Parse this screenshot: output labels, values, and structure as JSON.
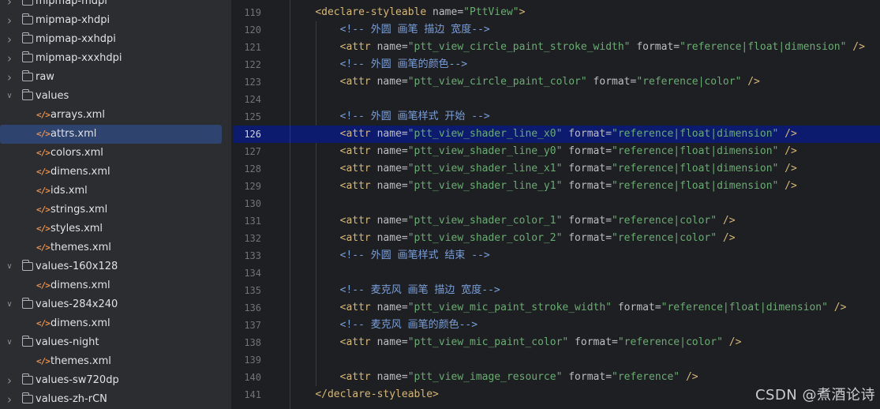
{
  "project_tree": [
    {
      "label": "mipmap-mdpi",
      "type": "folder",
      "depth": 0,
      "expanded": false
    },
    {
      "label": "mipmap-xhdpi",
      "type": "folder",
      "depth": 0,
      "expanded": false
    },
    {
      "label": "mipmap-xxhdpi",
      "type": "folder",
      "depth": 0,
      "expanded": false
    },
    {
      "label": "mipmap-xxxhdpi",
      "type": "folder",
      "depth": 0,
      "expanded": false
    },
    {
      "label": "raw",
      "type": "folder",
      "depth": 0,
      "expanded": false
    },
    {
      "label": "values",
      "type": "folder",
      "depth": 0,
      "expanded": true
    },
    {
      "label": "arrays.xml",
      "type": "xml",
      "depth": 1
    },
    {
      "label": "attrs.xml",
      "type": "xml",
      "depth": 1,
      "selected": true
    },
    {
      "label": "colors.xml",
      "type": "xml",
      "depth": 1
    },
    {
      "label": "dimens.xml",
      "type": "xml",
      "depth": 1
    },
    {
      "label": "ids.xml",
      "type": "xml",
      "depth": 1
    },
    {
      "label": "strings.xml",
      "type": "xml",
      "depth": 1
    },
    {
      "label": "styles.xml",
      "type": "xml",
      "depth": 1
    },
    {
      "label": "themes.xml",
      "type": "xml",
      "depth": 1
    },
    {
      "label": "values-160x128",
      "type": "folder",
      "depth": 0,
      "expanded": true
    },
    {
      "label": "dimens.xml",
      "type": "xml",
      "depth": 1
    },
    {
      "label": "values-284x240",
      "type": "folder",
      "depth": 0,
      "expanded": true
    },
    {
      "label": "dimens.xml",
      "type": "xml",
      "depth": 1
    },
    {
      "label": "values-night",
      "type": "folder",
      "depth": 0,
      "expanded": true
    },
    {
      "label": "themes.xml",
      "type": "xml",
      "depth": 1
    },
    {
      "label": "values-sw720dp",
      "type": "folder",
      "depth": 0,
      "expanded": false
    },
    {
      "label": "values-zh-rCN",
      "type": "folder",
      "depth": 0,
      "expanded": false
    }
  ],
  "icons": {
    "folder": "folder-icon",
    "xml": "xml-file-icon",
    "expanded": "chevron-down-icon",
    "collapsed": "chevron-right-icon",
    "intention": "lightbulb-icon"
  },
  "editor": {
    "active_line": 126,
    "lines": [
      {
        "num": "119",
        "indent": 1,
        "tokens": [
          {
            "t": "<declare-styleable",
            "c": "tag"
          },
          {
            "t": " name",
            "c": "attr"
          },
          {
            "t": "=",
            "c": "punc"
          },
          {
            "t": "\"PttView\"",
            "c": "val"
          },
          {
            "t": ">",
            "c": "tag"
          }
        ]
      },
      {
        "num": "120",
        "indent": 2,
        "tokens": [
          {
            "t": "<!-- 外圆 画笔 描边 宽度-->",
            "c": "com"
          }
        ]
      },
      {
        "num": "121",
        "indent": 2,
        "tokens": [
          {
            "t": "<attr",
            "c": "tag"
          },
          {
            "t": " name",
            "c": "attr"
          },
          {
            "t": "=",
            "c": "punc"
          },
          {
            "t": "\"ptt_view_circle_paint_stroke_width\"",
            "c": "val"
          },
          {
            "t": " format",
            "c": "attr"
          },
          {
            "t": "=",
            "c": "punc"
          },
          {
            "t": "\"reference|float|dimension\"",
            "c": "val"
          },
          {
            "t": " />",
            "c": "tag"
          }
        ]
      },
      {
        "num": "122",
        "indent": 2,
        "tokens": [
          {
            "t": "<!-- 外圆 画笔的颜色-->",
            "c": "com"
          }
        ]
      },
      {
        "num": "123",
        "indent": 2,
        "tokens": [
          {
            "t": "<attr",
            "c": "tag"
          },
          {
            "t": " name",
            "c": "attr"
          },
          {
            "t": "=",
            "c": "punc"
          },
          {
            "t": "\"ptt_view_circle_paint_color\"",
            "c": "val"
          },
          {
            "t": " format",
            "c": "attr"
          },
          {
            "t": "=",
            "c": "punc"
          },
          {
            "t": "\"reference|color\"",
            "c": "val"
          },
          {
            "t": " />",
            "c": "tag"
          }
        ]
      },
      {
        "num": "124",
        "indent": 0,
        "tokens": []
      },
      {
        "num": "125",
        "indent": 2,
        "tokens": [
          {
            "t": "<!-- 外圆 画笔样式 开始 -->",
            "c": "com"
          }
        ]
      },
      {
        "num": "126",
        "indent": 2,
        "tokens": [
          {
            "t": "<attr",
            "c": "tag"
          },
          {
            "t": " name",
            "c": "attr"
          },
          {
            "t": "=",
            "c": "punc"
          },
          {
            "t": "\"ptt_view_shader_line_x0\"",
            "c": "val"
          },
          {
            "t": " format",
            "c": "attr"
          },
          {
            "t": "=",
            "c": "punc"
          },
          {
            "t": "\"reference|float|dimension\"",
            "c": "val"
          },
          {
            "t": " />",
            "c": "tag"
          }
        ]
      },
      {
        "num": "127",
        "indent": 2,
        "tokens": [
          {
            "t": "<attr",
            "c": "tag"
          },
          {
            "t": " name",
            "c": "attr"
          },
          {
            "t": "=",
            "c": "punc"
          },
          {
            "t": "\"ptt_view_shader_line_y0\"",
            "c": "val"
          },
          {
            "t": " format",
            "c": "attr"
          },
          {
            "t": "=",
            "c": "punc"
          },
          {
            "t": "\"reference|float|dimension\"",
            "c": "val"
          },
          {
            "t": " />",
            "c": "tag"
          }
        ]
      },
      {
        "num": "128",
        "indent": 2,
        "tokens": [
          {
            "t": "<attr",
            "c": "tag"
          },
          {
            "t": " name",
            "c": "attr"
          },
          {
            "t": "=",
            "c": "punc"
          },
          {
            "t": "\"ptt_view_shader_line_x1\"",
            "c": "val"
          },
          {
            "t": " format",
            "c": "attr"
          },
          {
            "t": "=",
            "c": "punc"
          },
          {
            "t": "\"reference|float|dimension\"",
            "c": "val"
          },
          {
            "t": " />",
            "c": "tag"
          }
        ]
      },
      {
        "num": "129",
        "indent": 2,
        "tokens": [
          {
            "t": "<attr",
            "c": "tag"
          },
          {
            "t": " name",
            "c": "attr"
          },
          {
            "t": "=",
            "c": "punc"
          },
          {
            "t": "\"ptt_view_shader_line_y1\"",
            "c": "val"
          },
          {
            "t": " format",
            "c": "attr"
          },
          {
            "t": "=",
            "c": "punc"
          },
          {
            "t": "\"reference|float|dimension\"",
            "c": "val"
          },
          {
            "t": " />",
            "c": "tag"
          }
        ]
      },
      {
        "num": "130",
        "indent": 0,
        "tokens": []
      },
      {
        "num": "131",
        "indent": 2,
        "tokens": [
          {
            "t": "<attr",
            "c": "tag"
          },
          {
            "t": " name",
            "c": "attr"
          },
          {
            "t": "=",
            "c": "punc"
          },
          {
            "t": "\"ptt_view_shader_color_1\"",
            "c": "val"
          },
          {
            "t": " format",
            "c": "attr"
          },
          {
            "t": "=",
            "c": "punc"
          },
          {
            "t": "\"reference|color\"",
            "c": "val"
          },
          {
            "t": " />",
            "c": "tag"
          }
        ]
      },
      {
        "num": "132",
        "indent": 2,
        "tokens": [
          {
            "t": "<attr",
            "c": "tag"
          },
          {
            "t": " name",
            "c": "attr"
          },
          {
            "t": "=",
            "c": "punc"
          },
          {
            "t": "\"ptt_view_shader_color_2\"",
            "c": "val"
          },
          {
            "t": " format",
            "c": "attr"
          },
          {
            "t": "=",
            "c": "punc"
          },
          {
            "t": "\"reference|color\"",
            "c": "val"
          },
          {
            "t": " />",
            "c": "tag"
          }
        ]
      },
      {
        "num": "133",
        "indent": 2,
        "tokens": [
          {
            "t": "<!-- 外圆 画笔样式 结束 -->",
            "c": "com"
          }
        ]
      },
      {
        "num": "134",
        "indent": 0,
        "tokens": []
      },
      {
        "num": "135",
        "indent": 2,
        "tokens": [
          {
            "t": "<!-- 麦克风 画笔 描边 宽度-->",
            "c": "com"
          }
        ]
      },
      {
        "num": "136",
        "indent": 2,
        "tokens": [
          {
            "t": "<attr",
            "c": "tag"
          },
          {
            "t": " name",
            "c": "attr"
          },
          {
            "t": "=",
            "c": "punc"
          },
          {
            "t": "\"ptt_view_mic_paint_stroke_width\"",
            "c": "val"
          },
          {
            "t": " format",
            "c": "attr"
          },
          {
            "t": "=",
            "c": "punc"
          },
          {
            "t": "\"reference|float|dimension\"",
            "c": "val"
          },
          {
            "t": " />",
            "c": "tag"
          }
        ]
      },
      {
        "num": "137",
        "indent": 2,
        "tokens": [
          {
            "t": "<!-- 麦克风 画笔的颜色-->",
            "c": "com"
          }
        ]
      },
      {
        "num": "138",
        "indent": 2,
        "tokens": [
          {
            "t": "<attr",
            "c": "tag"
          },
          {
            "t": " name",
            "c": "attr"
          },
          {
            "t": "=",
            "c": "punc"
          },
          {
            "t": "\"ptt_view_mic_paint_color\"",
            "c": "val"
          },
          {
            "t": " format",
            "c": "attr"
          },
          {
            "t": "=",
            "c": "punc"
          },
          {
            "t": "\"reference|color\"",
            "c": "val"
          },
          {
            "t": " />",
            "c": "tag"
          }
        ]
      },
      {
        "num": "139",
        "indent": 0,
        "tokens": []
      },
      {
        "num": "140",
        "indent": 2,
        "tokens": [
          {
            "t": "<attr",
            "c": "tag"
          },
          {
            "t": " name",
            "c": "attr"
          },
          {
            "t": "=",
            "c": "punc"
          },
          {
            "t": "\"ptt_view_image_resource\"",
            "c": "val"
          },
          {
            "t": " format",
            "c": "attr"
          },
          {
            "t": "=",
            "c": "punc"
          },
          {
            "t": "\"reference\"",
            "c": "val"
          },
          {
            "t": " />",
            "c": "tag"
          }
        ]
      },
      {
        "num": "141",
        "indent": 1,
        "tokens": [
          {
            "t": "</declare-styleable>",
            "c": "tag"
          }
        ]
      }
    ]
  },
  "watermark": "CSDN @煮酒论诗",
  "colors": {
    "selection": "#2e436e",
    "active_line": "#0d1b6f",
    "tag": "#d5b778",
    "value": "#6aab73",
    "comment": "#7a9fd9"
  }
}
